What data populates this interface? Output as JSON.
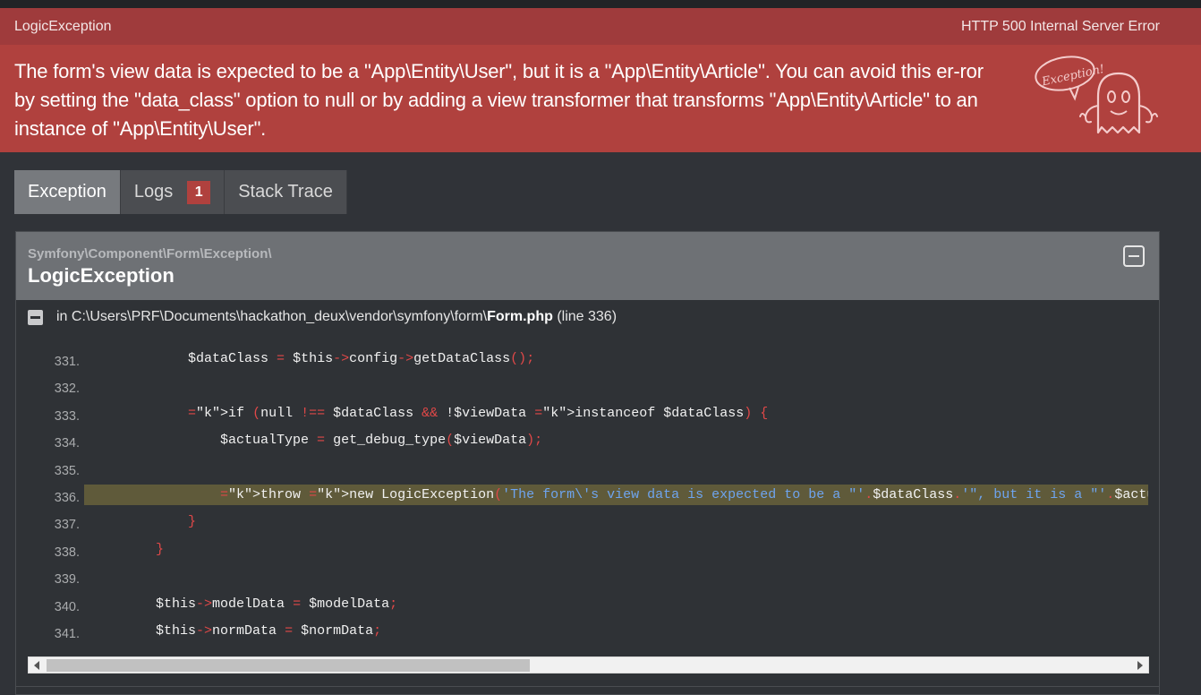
{
  "exception": {
    "class_short": "LogicException",
    "status": "HTTP 500 Internal Server Error",
    "message": "The form's view data is expected to be a \"App\\Entity\\User\", but it is a \"App\\Entity\\Article\". You can avoid this er-ror by setting the \"data_class\" option to null or by adding a view transformer that transforms \"App\\Entity\\Article\" to an instance of \"App\\Entity\\User\".",
    "badge_text": "Exception!"
  },
  "tabs": [
    {
      "label": "Exception",
      "active": true
    },
    {
      "label": "Logs",
      "badge": "1"
    },
    {
      "label": "Stack Trace"
    }
  ],
  "panel": {
    "namespace": "Symfony\\Component\\Form\\Exception\\",
    "title": "LogicException",
    "trace_prefix": "in C:\\Users\\PRF\\Documents\\hackathon_deux\\vendor\\symfony\\form\\",
    "trace_file": "Form.php",
    "trace_line": "(line 336)"
  },
  "code_lines": [
    {
      "n": "331.",
      "code": "            $dataClass = $this->config->getDataClass();"
    },
    {
      "n": "332.",
      "code": ""
    },
    {
      "n": "333.",
      "code": "            if (null !== $dataClass && !$viewData instanceof $dataClass) {"
    },
    {
      "n": "334.",
      "code": "                $actualType = get_debug_type($viewData);"
    },
    {
      "n": "335.",
      "code": ""
    },
    {
      "n": "336.",
      "code": "                throw new LogicException('The form\\'s view data is expected to be a \"'.$dataClass.'\", but it is a \"'.$actualType.'\".",
      "selected": true
    },
    {
      "n": "337.",
      "code": "            }"
    },
    {
      "n": "338.",
      "code": "        }"
    },
    {
      "n": "339.",
      "code": ""
    },
    {
      "n": "340.",
      "code": "        $this->modelData = $modelData;"
    },
    {
      "n": "341.",
      "code": "        $this->normData = $normData;"
    }
  ],
  "colors": {
    "header_red": "#9f3b3c",
    "message_red": "#b0413e",
    "background": "#303338",
    "keyword": "#e04848",
    "string": "#6ea4ee",
    "highlight_line": "#5f5a3a"
  }
}
